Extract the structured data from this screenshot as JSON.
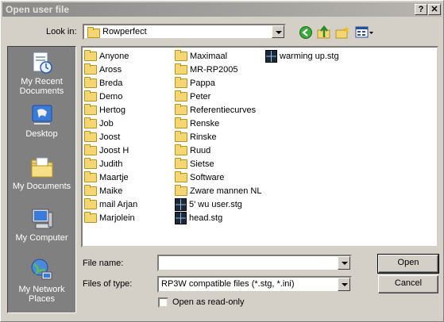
{
  "window": {
    "title": "Open user file",
    "help_label": "?",
    "close_label": "✕"
  },
  "lookin": {
    "label": "Look in:",
    "value": "Rowperfect"
  },
  "places": [
    {
      "label": "My Recent Documents",
      "icon": "recent-documents-icon"
    },
    {
      "label": "Desktop",
      "icon": "desktop-icon"
    },
    {
      "label": "My Documents",
      "icon": "my-documents-icon"
    },
    {
      "label": "My Computer",
      "icon": "my-computer-icon"
    },
    {
      "label": "My Network Places",
      "icon": "network-places-icon"
    }
  ],
  "files": {
    "col1": [
      {
        "name": "Anyone",
        "type": "folder"
      },
      {
        "name": "Aross",
        "type": "folder"
      },
      {
        "name": "Breda",
        "type": "folder"
      },
      {
        "name": "Demo",
        "type": "folder"
      },
      {
        "name": "Hertog",
        "type": "folder"
      },
      {
        "name": "Job",
        "type": "folder"
      },
      {
        "name": "Joost",
        "type": "folder"
      },
      {
        "name": "Joost H",
        "type": "folder"
      },
      {
        "name": "Judith",
        "type": "folder"
      },
      {
        "name": "Maartje",
        "type": "folder"
      },
      {
        "name": "Maike",
        "type": "folder"
      },
      {
        "name": "mail Arjan",
        "type": "folder"
      },
      {
        "name": "Marjolein",
        "type": "folder"
      }
    ],
    "col2": [
      {
        "name": "Maximaal",
        "type": "folder"
      },
      {
        "name": "MR-RP2005",
        "type": "folder"
      },
      {
        "name": "Pappa",
        "type": "folder"
      },
      {
        "name": "Peter",
        "type": "folder"
      },
      {
        "name": "Referentiecurves",
        "type": "folder"
      },
      {
        "name": "Renske",
        "type": "folder"
      },
      {
        "name": "Rinske",
        "type": "folder"
      },
      {
        "name": "Ruud",
        "type": "folder"
      },
      {
        "name": "Sietse",
        "type": "folder"
      },
      {
        "name": "Software",
        "type": "folder"
      },
      {
        "name": "Zware mannen NL",
        "type": "folder"
      },
      {
        "name": "5' wu user.stg",
        "type": "file"
      },
      {
        "name": "head.stg",
        "type": "file"
      }
    ],
    "col3": [
      {
        "name": "warming up.stg",
        "type": "file"
      }
    ]
  },
  "filename": {
    "label": "File name:",
    "value": ""
  },
  "filetype": {
    "label": "Files of type:",
    "value": "RP3W compatible files (*.stg, *.ini)"
  },
  "readonly": {
    "label": "Open as read-only",
    "checked": false
  },
  "buttons": {
    "open": "Open",
    "cancel": "Cancel"
  }
}
